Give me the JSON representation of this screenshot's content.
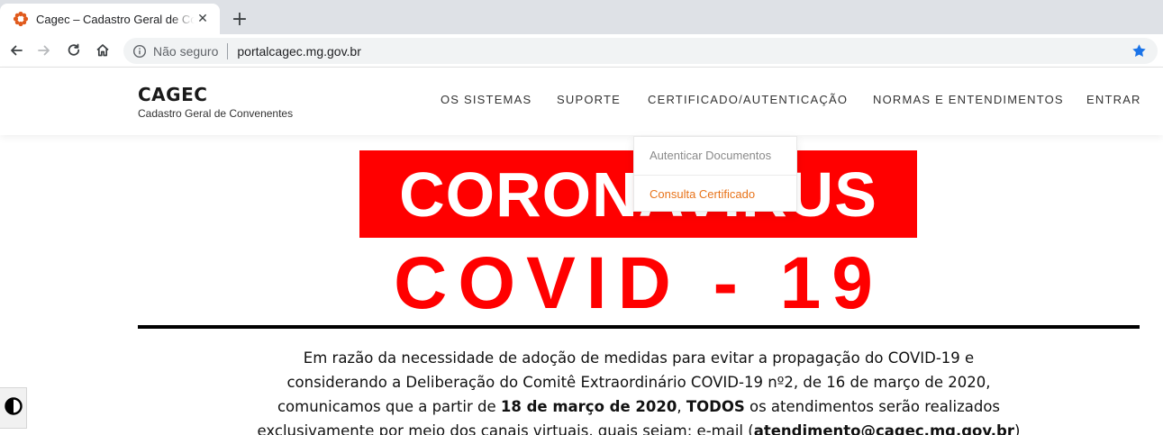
{
  "browser": {
    "tab": {
      "title": "Cagec – Cadastro Geral de Convenentes",
      "close_label": "✕",
      "favicon": "cagec-flower-icon"
    },
    "new_tab_label": "+",
    "omnibox": {
      "security_text": "Não seguro",
      "url": "portalcagec.mg.gov.br"
    },
    "accent_color": "#1a73e8"
  },
  "site": {
    "brand": {
      "title": "CAGEC",
      "subtitle": "Cadastro Geral de Convenentes"
    },
    "nav": [
      {
        "label": "OS SISTEMAS"
      },
      {
        "label": "SUPORTE"
      },
      {
        "label": "CERTIFICADO/AUTENTICAÇÃO"
      },
      {
        "label": "NORMAS E ENTENDIMENTOS"
      },
      {
        "label": "ENTRAR"
      }
    ],
    "dropdown": [
      {
        "label": "Autenticar Documentos",
        "color": "#8a8a8a"
      },
      {
        "label": "Consulta Certificado",
        "color": "#e8731a"
      }
    ]
  },
  "banner": {
    "line1": "CORONAVIRUS",
    "line2": "COVID - 19",
    "red": "#ff0000"
  },
  "notice": {
    "line1": "Em razão da necessidade de adoção de medidas para evitar a propagação do COVID-19 e",
    "line2": "considerando a Deliberação do Comitê Extraordinário COVID-19 nº2, de 16 de março de 2020,",
    "line3_a": "comunicamos que a partir de ",
    "line3_date": "18 de março de 2020",
    "line3_sep": ", ",
    "line3_todos": "TODOS",
    "line3_b": " os atendimentos serão realizados",
    "line4_a": "exclusivamente por meio dos canais virtuais, quais sejam: e-mail (",
    "line4_email": "atendimento@cagec.mg.gov.br",
    "line4_b": ")"
  }
}
